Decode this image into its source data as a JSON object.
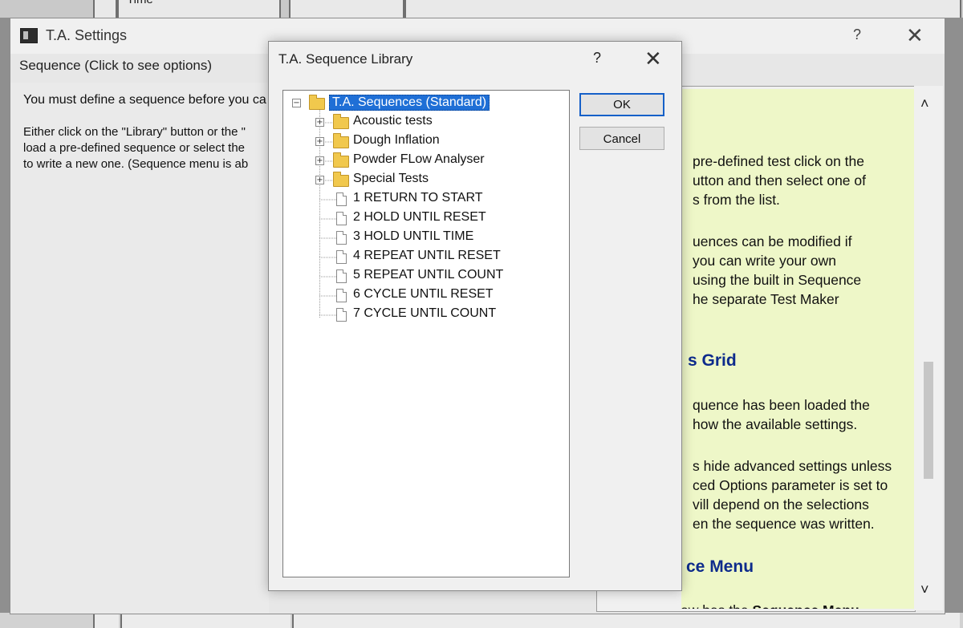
{
  "background": {
    "top_text": "Time"
  },
  "main_window": {
    "title": "T.A. Settings",
    "help_glyph": "?",
    "close_glyph": "✕",
    "sequence_label": "Sequence (Click to see options)",
    "instructions": {
      "line1": "You must define a sequence before you ca",
      "line2": "Either click on the \"Library\" button or the \"",
      "line3": "load a pre-defined sequence or select the",
      "line4": "to write a new one. (Sequence menu is ab"
    },
    "help_panel": {
      "p1_l1": "pre-defined test click on the",
      "p1_l2": "utton and then select one of",
      "p1_l3": "s from the list.",
      "p2_l1": "uences can be modified if",
      "p2_l2": " you can write your own",
      "p2_l3": "using the built in Sequence",
      "p2_l4": "he separate Test Maker",
      "h1": "s Grid",
      "p3_l1": "quence has been loaded the",
      "p3_l2": "how the available settings.",
      "p4_l1": "s hide advanced settings unless",
      "p4_l2": "ced Options parameter is set to",
      "p4_l3": "vill depend on the selections",
      "p4_l4": "en the sequence was written.",
      "h2": "ce Menu",
      "p5_pre": "The window has the ",
      "p5_bold": "Sequence Menu"
    },
    "scroll_up_glyph": "˄",
    "scroll_down_glyph": "˅"
  },
  "dialog": {
    "title": "T.A. Sequence Library",
    "help_glyph": "?",
    "close_glyph": "✕",
    "ok_label": "OK",
    "cancel_label": "Cancel",
    "tree": {
      "root": "T.A. Sequences (Standard)",
      "folders": [
        "Acoustic tests",
        "Dough Inflation",
        "Powder FLow Analyser",
        "Special Tests"
      ],
      "items": [
        "1 RETURN TO START",
        "2 HOLD UNTIL RESET",
        "3 HOLD UNTIL TIME",
        "4 REPEAT UNTIL RESET",
        "5 REPEAT UNTIL COUNT",
        "6 CYCLE UNTIL RESET",
        "7 CYCLE UNTIL COUNT"
      ],
      "expand_glyph": "+",
      "collapse_glyph": "−"
    }
  }
}
